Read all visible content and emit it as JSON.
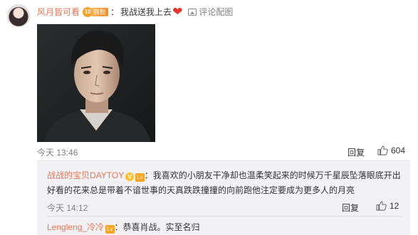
{
  "comment": {
    "username": "风月皆可看",
    "fan_badge_level": "10",
    "fan_badge_text": "铁粉",
    "separator": "：",
    "text": "我战送我上去",
    "heart": "❤",
    "pic_link": "评论配图",
    "time": "今天 13:46",
    "reply_label": "回复",
    "like_count": "604"
  },
  "replies": [
    {
      "username": "战战的宝贝DAYTOY",
      "verified_badge": "V",
      "level_badge": "Lv",
      "separator": "：",
      "text": "我喜欢的小朋友干净却也温柔笑起来的时候万千星辰坠落眼底开出好看的花来总是带着不谙世事的天真跌跌撞撞的向前跑他注定要成为更多人的月亮",
      "time": "今天 14:12",
      "reply_label": "回复",
      "like_count": "12"
    },
    {
      "username": "Lengleng_冷冷",
      "level_badge": "Lv",
      "separator": "：",
      "text": "恭喜肖战。实至名归"
    }
  ],
  "icons": {
    "picture": "picture-icon",
    "thumb": "thumbs-up-icon"
  },
  "colors": {
    "username": "#eb7350",
    "meta_gray": "#808080",
    "reply_bg": "#f2f2f5",
    "heart": "#e5342c"
  }
}
